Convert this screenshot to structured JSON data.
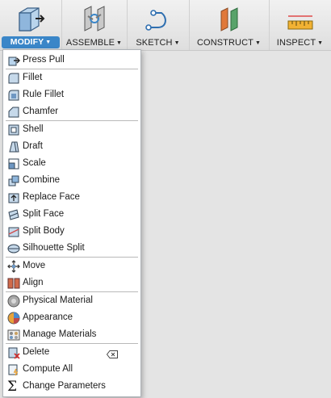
{
  "toolbar": {
    "tools": [
      {
        "label": "MODIFY",
        "icon": "press-pull-cube-icon",
        "active": true
      },
      {
        "label": "ASSEMBLE",
        "icon": "joint-icon",
        "active": false
      },
      {
        "label": "SKETCH",
        "icon": "sketch-curve-icon",
        "active": false
      },
      {
        "label": "CONSTRUCT",
        "icon": "plane-icon",
        "active": false
      },
      {
        "label": "INSPECT",
        "icon": "ruler-icon",
        "active": false
      }
    ]
  },
  "menu": {
    "groups": [
      [
        {
          "label": "Press Pull",
          "icon": "press-pull-icon"
        }
      ],
      [
        {
          "label": "Fillet",
          "icon": "fillet-icon"
        },
        {
          "label": "Rule Fillet",
          "icon": "rule-fillet-icon"
        },
        {
          "label": "Chamfer",
          "icon": "chamfer-icon"
        }
      ],
      [
        {
          "label": "Shell",
          "icon": "shell-icon"
        },
        {
          "label": "Draft",
          "icon": "draft-icon"
        },
        {
          "label": "Scale",
          "icon": "scale-icon"
        },
        {
          "label": "Combine",
          "icon": "combine-icon"
        },
        {
          "label": "Replace Face",
          "icon": "replace-face-icon"
        },
        {
          "label": "Split Face",
          "icon": "split-face-icon"
        },
        {
          "label": "Split Body",
          "icon": "split-body-icon"
        },
        {
          "label": "Silhouette Split",
          "icon": "silhouette-split-icon"
        }
      ],
      [
        {
          "label": "Move",
          "icon": "move-icon"
        },
        {
          "label": "Align",
          "icon": "align-icon"
        }
      ],
      [
        {
          "label": "Physical Material",
          "icon": "physical-material-icon"
        },
        {
          "label": "Appearance",
          "icon": "appearance-icon"
        },
        {
          "label": "Manage Materials",
          "icon": "manage-materials-icon"
        }
      ],
      [
        {
          "label": "Delete",
          "icon": "delete-icon",
          "shortcut_icon": "delete-key-icon"
        },
        {
          "label": "Compute All",
          "icon": "compute-all-icon"
        },
        {
          "label": "Change Parameters",
          "icon": "change-parameters-icon"
        }
      ]
    ]
  },
  "colors": {
    "accent": "#3a86c8",
    "menu_bg": "#ffffff",
    "workspace_bg": "#e4e4e4"
  }
}
